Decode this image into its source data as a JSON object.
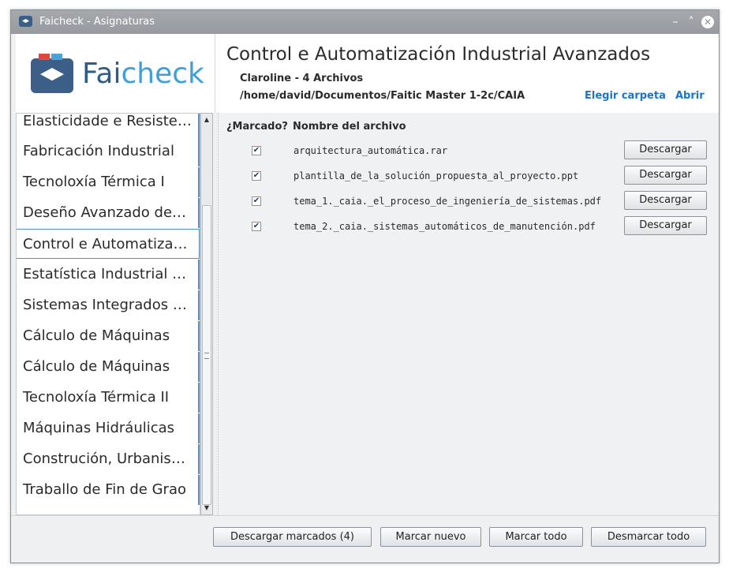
{
  "window": {
    "title": "Faicheck - Asignaturas"
  },
  "logo": {
    "part1": "Fai",
    "part2": "check"
  },
  "header": {
    "subject_title": "Control e Automatización Industrial Avanzados",
    "subinfo": "Claroline - 4 Archivos",
    "path": "/home/david/Documentos/Faitic Master 1-2c/CAIA",
    "choose_folder": "Elegir carpeta",
    "open": "Abrir"
  },
  "sidebar": {
    "items": [
      {
        "label": "Elasticidade e Resiste…"
      },
      {
        "label": "Fabricación Industrial"
      },
      {
        "label": "Tecnoloxía Térmica I"
      },
      {
        "label": "Deseño Avanzado de…"
      },
      {
        "label": "Control e Automatiza…"
      },
      {
        "label": "Estatística Industrial …"
      },
      {
        "label": "Sistemas Integrados …"
      },
      {
        "label": "Cálculo de Máquinas"
      },
      {
        "label": "Cálculo de Máquinas"
      },
      {
        "label": "Tecnoloxía Térmica II"
      },
      {
        "label": "Máquinas Hidráulicas"
      },
      {
        "label": "Construción, Urbanis…"
      },
      {
        "label": "Traballo de Fin de Grao"
      }
    ],
    "selected_index": 4
  },
  "files": {
    "col_marked": "¿Marcado?",
    "col_name": "Nombre del archivo",
    "download_label": "Descargar",
    "rows": [
      {
        "name": "arquitectura_automática.rar",
        "checked": true
      },
      {
        "name": "plantilla_de_la_solución_propuesta_al_proyecto.ppt",
        "checked": true
      },
      {
        "name": "tema_1._caia._el_proceso_de_ingeniería_de_sistemas.pdf",
        "checked": true
      },
      {
        "name": "tema_2._caia._sistemas_automáticos_de_manutención.pdf",
        "checked": true
      }
    ]
  },
  "bottom": {
    "download_marked": "Descargar marcados (4)",
    "mark_new": "Marcar nuevo",
    "mark_all": "Marcar todo",
    "unmark_all": "Desmarcar todo"
  }
}
